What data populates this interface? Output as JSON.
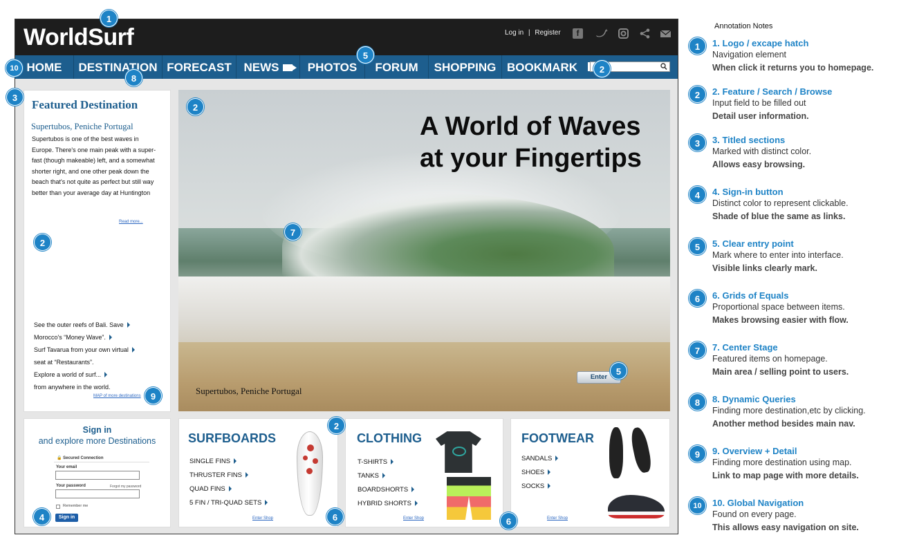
{
  "site": {
    "logo": "WorldSurf",
    "auth": {
      "login": "Log in",
      "separator": "|",
      "register": "Register"
    },
    "social": {
      "facebook": "f",
      "twitter": "twitter-bird",
      "instagram": "instagram-camera",
      "share": "share",
      "email": "envelope"
    },
    "nav": [
      "HOME",
      "DESTINATION",
      "FORECAST",
      "NEWS",
      "PHOTOS",
      "FORUM",
      "SHOPPING",
      "BOOKMARK"
    ],
    "search": {
      "placeholder": ""
    },
    "featured": {
      "title": "Featured Destination",
      "subtitle": "Supertubos, Peniche Portugal",
      "body": "Supertubos is one of the best waves in Europe. There's one main peak with a super-fast (though makeable) left, and a somewhat shorter right, and one other peak down the beach that's not quite as perfect but still way better than your average day at Huntington",
      "read_more": "Read more...",
      "links": [
        "See the outer reefs of Bali. Save",
        "Morocco's “Money Wave”.",
        "Surf Tavarua from your own virtual",
        "seat at “Restaurants”.",
        "Explore a world of surf...",
        "from anywhere in the world."
      ],
      "map_link": "MAP of more destinations"
    },
    "hero": {
      "title_line1": "A World of Waves",
      "title_line2": "at your Fingertips",
      "caption": "Supertubos, Peniche Portugal",
      "enter": "Enter"
    },
    "signin": {
      "title": "Sign in",
      "subtitle": "and explore more Destinations",
      "secure": "Secured Connection",
      "email_label": "Your email",
      "password_label": "Your password",
      "forgot": "Forgot my password",
      "remember": "Remember me",
      "button": "Sign in"
    },
    "shop": [
      {
        "title": "SURFBOARDS",
        "items": [
          "SINGLE FINS",
          "THRUSTER FINS",
          "QUAD FINS",
          "5 FIN / TRI-QUAD SETS"
        ],
        "enter": "Enter Shop"
      },
      {
        "title": "CLOTHING",
        "items": [
          "T-SHIRTS",
          "TANKS",
          "BOARDSHORTS",
          "HYBRID SHORTS"
        ],
        "enter": "Enter Shop"
      },
      {
        "title": "FOOTWEAR",
        "items": [
          "SANDALS",
          "SHOES",
          "SOCKS"
        ],
        "enter": "Enter Shop"
      }
    ]
  },
  "markers": [
    "1",
    "2",
    "3",
    "4",
    "5",
    "6",
    "7",
    "8",
    "9",
    "10"
  ],
  "notes": {
    "title": "Annotation Notes",
    "items": [
      {
        "num": "1",
        "title": "1. Logo / excape hatch",
        "desc": "Navigation element",
        "bold": "When click it returns you to homepage."
      },
      {
        "num": "2",
        "title": "2. Feature / Search / Browse",
        "desc": "Input field to be filled out",
        "bold": "Detail user information."
      },
      {
        "num": "3",
        "title": "3. Titled sections",
        "desc": "Marked with distinct color.",
        "bold": "Allows easy browsing."
      },
      {
        "num": "4",
        "title": "4. Sign-in button",
        "desc": "Distinct color to represent clickable.",
        "bold": "Shade of blue the same as links."
      },
      {
        "num": "5",
        "title": "5. Clear entry point",
        "desc": "Mark where to enter into interface.",
        "bold": "Visible links clearly mark."
      },
      {
        "num": "6",
        "title": "6. Grids of Equals",
        "desc": "Proportional space between items.",
        "bold": "Makes browsing easier with flow."
      },
      {
        "num": "7",
        "title": "7. Center Stage",
        "desc": "Featured items on homepage.",
        "bold": "Main area / selling point to users."
      },
      {
        "num": "8",
        "title": "8. Dynamic Queries",
        "desc": "Finding more destination,etc by clicking.",
        "bold": "Another method besides main nav."
      },
      {
        "num": "9",
        "title": "9. Overview + Detail",
        "desc": "Finding more destination using map.",
        "bold": "Link to map page with more details."
      },
      {
        "num": "10",
        "title": "10. Global Navigation",
        "desc": "Found on every page.",
        "bold": "This allows easy navigation on site."
      }
    ]
  },
  "colors": {
    "nav": "#1d5e8e",
    "topbar": "#1d1d1d",
    "marker": "#1e83c6",
    "link": "#2a66c0"
  }
}
